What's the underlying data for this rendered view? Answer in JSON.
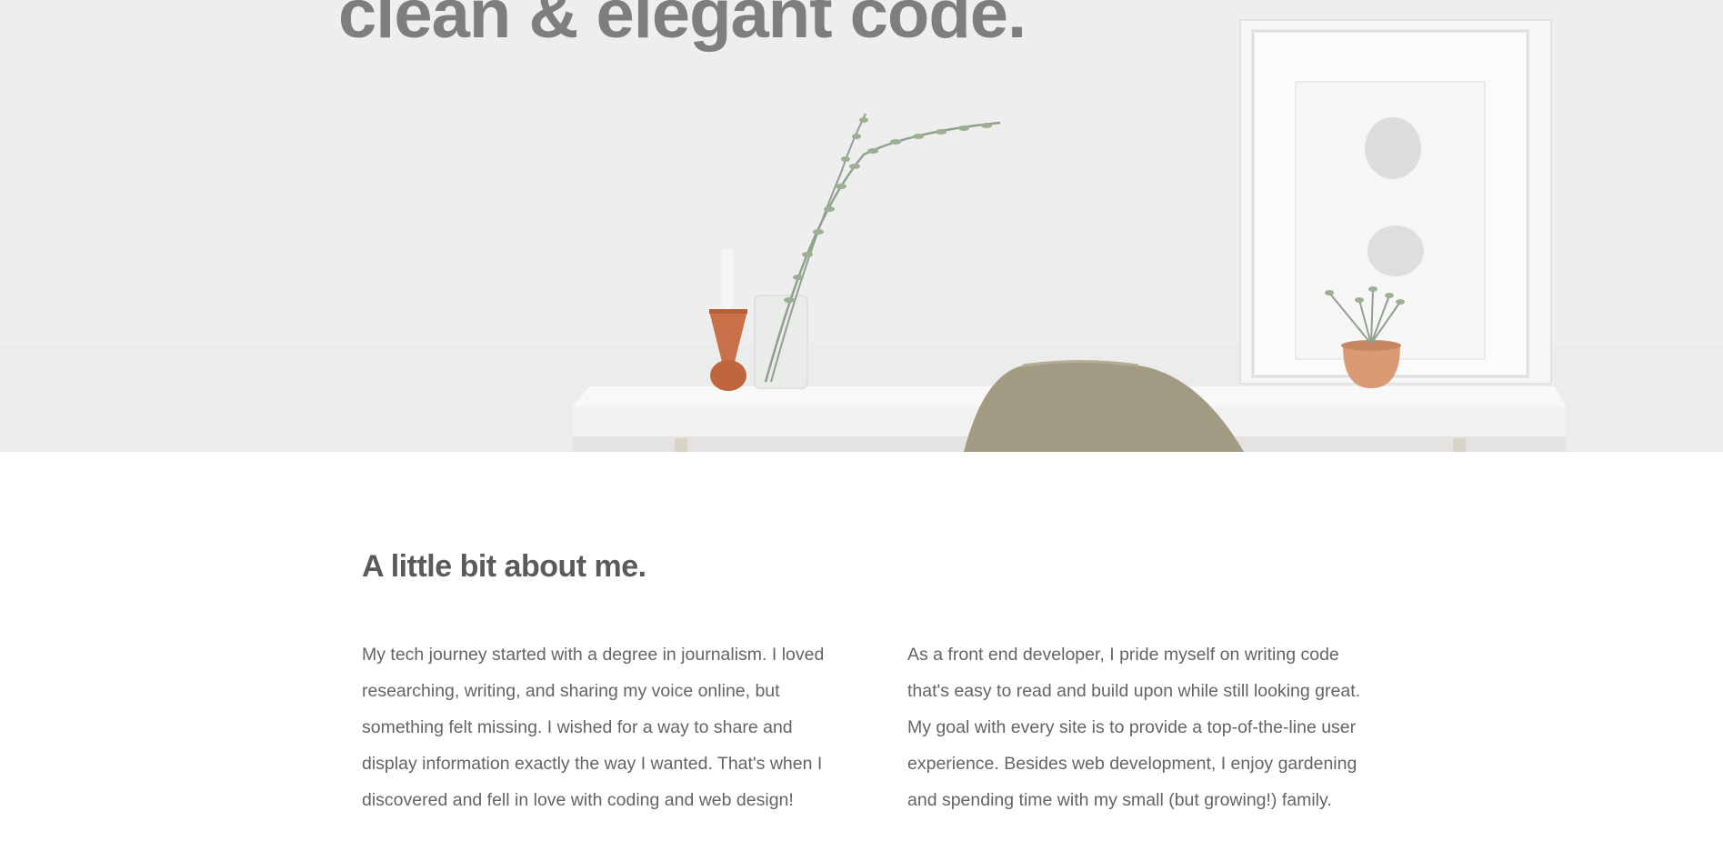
{
  "hero": {
    "title": "clean & elegant code."
  },
  "about": {
    "heading": "A little bit about me.",
    "paragraph_left": "My tech journey started with a degree in journalism. I loved researching, writing, and sharing my voice online, but something felt missing. I wished for a way to share and display information exactly the way I wanted. That's when I discovered and fell in love with coding and web design!",
    "paragraph_right": "As a front end developer, I pride myself on writing code that's easy to read and build upon while still looking great. My goal with every site is to provide a top-of-the-line user experience. Besides web development, I enjoy gardening and spending time with my small (but growing!) family."
  },
  "colors": {
    "hero_background": "#eeeeef",
    "hero_title": "#7e7e7e",
    "heading": "#5a5a5a",
    "body_text": "#646464",
    "vase_copper": "#c8704a",
    "chair_taupe": "#a29a82"
  }
}
